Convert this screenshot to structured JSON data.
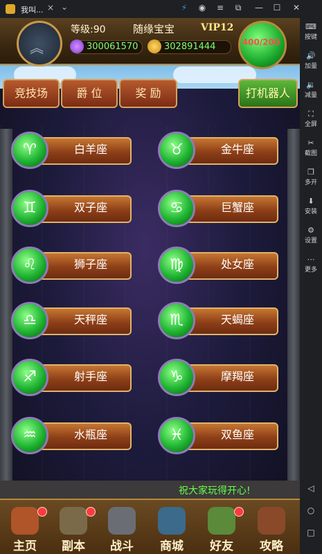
{
  "window": {
    "tab_title": "我叫...",
    "tab_close": "×",
    "tab_dropdown": "⌄",
    "controls": {
      "minimize": "—",
      "maximize": "☐",
      "close": "✕"
    }
  },
  "sidebar": {
    "items": [
      {
        "label": "按键",
        "icon": "⌨"
      },
      {
        "label": "加量",
        "icon": "🔊"
      },
      {
        "label": "减量",
        "icon": "🔉"
      },
      {
        "label": "全屏",
        "icon": "⛶"
      },
      {
        "label": "截图",
        "icon": "✂"
      },
      {
        "label": "多开",
        "icon": "❐"
      },
      {
        "label": "安装",
        "icon": "⬇"
      },
      {
        "label": "设置",
        "icon": "⚙"
      },
      {
        "label": "更多",
        "icon": "⋯"
      }
    ],
    "nav": {
      "back": "◁",
      "home": "○",
      "recent": "□"
    }
  },
  "header": {
    "level": "等级:90",
    "player_name": "随缘宝宝",
    "vip": "VIP12",
    "gems": "300061570",
    "coins": "302891444",
    "energy": "400/200"
  },
  "tabs": {
    "arena": "竞技场",
    "rank": "爵 位",
    "reward": "奖 励",
    "bot": "打机器人"
  },
  "zodiac": [
    {
      "label": "白羊座",
      "glyph": "♈"
    },
    {
      "label": "金牛座",
      "glyph": "♉"
    },
    {
      "label": "双子座",
      "glyph": "♊"
    },
    {
      "label": "巨蟹座",
      "glyph": "♋"
    },
    {
      "label": "狮子座",
      "glyph": "♌"
    },
    {
      "label": "处女座",
      "glyph": "♍"
    },
    {
      "label": "天秤座",
      "glyph": "♎"
    },
    {
      "label": "天蝎座",
      "glyph": "♏"
    },
    {
      "label": "射手座",
      "glyph": "♐"
    },
    {
      "label": "摩羯座",
      "glyph": "♑"
    },
    {
      "label": "水瓶座",
      "glyph": "♒"
    },
    {
      "label": "双鱼座",
      "glyph": "♓"
    }
  ],
  "footer_message": "祝大家玩得开心!",
  "bottom_nav": [
    {
      "label": "主页",
      "icon": "home-icon",
      "color": "#b0542a",
      "badge": true
    },
    {
      "label": "副本",
      "icon": "dungeon-icon",
      "color": "#7a6a4a",
      "badge": true
    },
    {
      "label": "战斗",
      "icon": "battle-icon",
      "color": "#6a6e74",
      "badge": false
    },
    {
      "label": "商城",
      "icon": "shop-icon",
      "color": "#3c6a8a",
      "badge": false
    },
    {
      "label": "好友",
      "icon": "friends-icon",
      "color": "#5a8a3a",
      "badge": true
    },
    {
      "label": "攻略",
      "icon": "guide-icon",
      "color": "#8a4a2a",
      "badge": false
    }
  ]
}
